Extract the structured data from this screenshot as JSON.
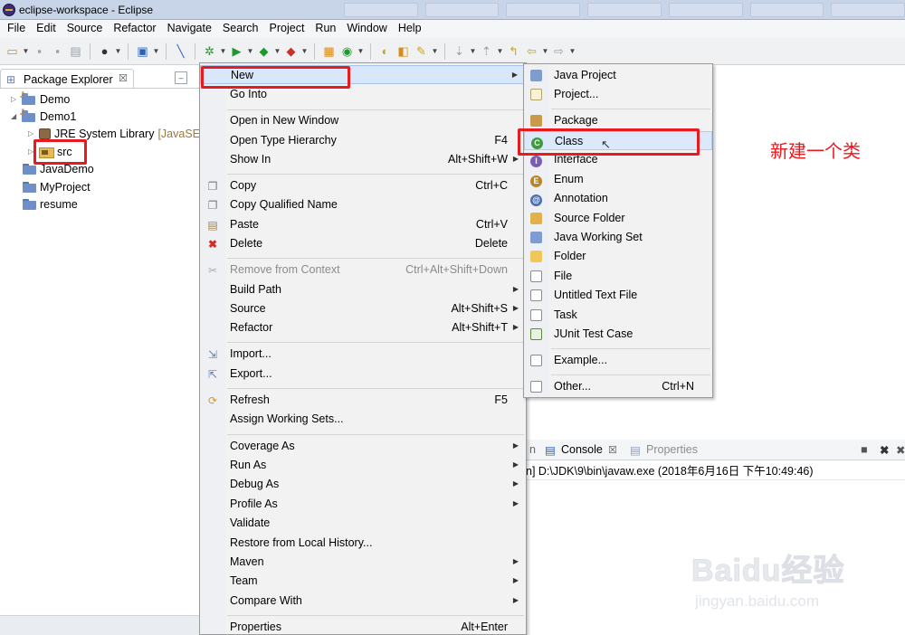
{
  "window": {
    "title": "eclipse-workspace - Eclipse"
  },
  "menubar": [
    "File",
    "Edit",
    "Source",
    "Refactor",
    "Navigate",
    "Search",
    "Project",
    "Run",
    "Window",
    "Help"
  ],
  "package_explorer": {
    "tab_label": "Package Explorer",
    "close_glyph": "☒",
    "tree": {
      "demo": "Demo",
      "demo1": "Demo1",
      "jre": "JRE System Library",
      "jre_suffix": "[JavaSE-",
      "src": "src",
      "javademo": "JavaDemo",
      "myproject": "MyProject",
      "resume": "resume"
    }
  },
  "context_menu": {
    "new": "New",
    "go_into": "Go Into",
    "open_new_window": "Open in New Window",
    "open_type_hierarchy": "Open Type Hierarchy",
    "open_type_hierarchy_key": "F4",
    "show_in": "Show In",
    "show_in_key": "Alt+Shift+W",
    "copy": "Copy",
    "copy_key": "Ctrl+C",
    "copy_qualified": "Copy Qualified Name",
    "paste": "Paste",
    "paste_key": "Ctrl+V",
    "delete": "Delete",
    "delete_key": "Delete",
    "remove_context": "Remove from Context",
    "remove_context_key": "Ctrl+Alt+Shift+Down",
    "build_path": "Build Path",
    "source": "Source",
    "source_key": "Alt+Shift+S",
    "refactor": "Refactor",
    "refactor_key": "Alt+Shift+T",
    "import": "Import...",
    "export": "Export...",
    "refresh": "Refresh",
    "refresh_key": "F5",
    "assign_working_sets": "Assign Working Sets...",
    "coverage_as": "Coverage As",
    "run_as": "Run As",
    "debug_as": "Debug As",
    "profile_as": "Profile As",
    "validate": "Validate",
    "restore_history": "Restore from Local History...",
    "maven": "Maven",
    "team": "Team",
    "compare_with": "Compare With",
    "properties": "Properties",
    "properties_key": "Alt+Enter"
  },
  "submenu": {
    "java_project": "Java Project",
    "project": "Project...",
    "package": "Package",
    "class": "Class",
    "interface": "Interface",
    "enum": "Enum",
    "annotation": "Annotation",
    "source_folder": "Source Folder",
    "java_working_set": "Java Working Set",
    "folder": "Folder",
    "file": "File",
    "untitled_text_file": "Untitled Text File",
    "task": "Task",
    "junit_test_case": "JUnit Test Case",
    "example": "Example...",
    "other": "Other...",
    "other_key": "Ctrl+N"
  },
  "annotation": "新建一个类",
  "console": {
    "partial_tab": "n",
    "console_tab": "Console",
    "close_glyph": "☒",
    "properties_tab": "Properties",
    "line": "n] D:\\JDK\\9\\bin\\javaw.exe (2018年6月16日 下午10:49:46)"
  },
  "watermark": {
    "logo": "Baidu经验",
    "url": "jingyan.baidu.com"
  },
  "colors": {
    "highlight_box": "#e8191f",
    "menu_bg": "#f2f2f2",
    "selection": "#dce9fb"
  }
}
